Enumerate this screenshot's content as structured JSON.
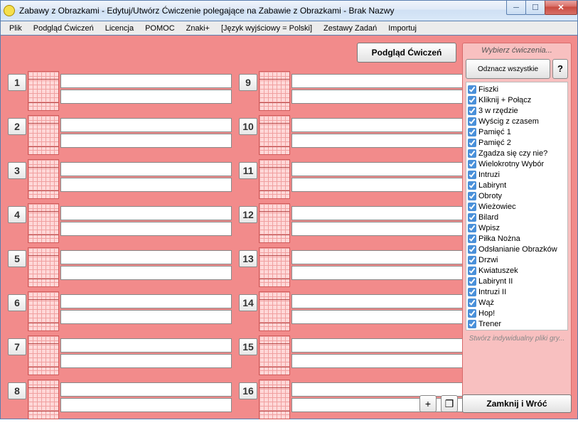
{
  "window": {
    "title": "Zabawy z Obrazkami - Edytuj/Utwórz Ćwiczenie polegające na Zabawie z Obrazkami - Brak Nazwy"
  },
  "menu": {
    "items": [
      "Plik",
      "Podgląd Ćwiczeń",
      "Licencja",
      "POMOC",
      "Znaki+",
      "[Język wyjściowy = Polski]",
      "Zestawy Zadań",
      "Importuj"
    ]
  },
  "buttons": {
    "preview": "Podgląd Ćwiczeń",
    "deselect_all": "Odznacz wszystkie",
    "help": "?",
    "close_return": "Zamknij i Wróć",
    "add": "+",
    "duplicate": "❐"
  },
  "right_panel": {
    "title": "Wybierz ćwiczenia...",
    "footer": "Stwórz indywidualny pliki gry...",
    "exercises": [
      "Fiszki",
      "Kliknij + Połącz",
      "3 w rzędzie",
      "Wyścig z czasem",
      "Pamięć 1",
      "Pamięć 2",
      "Zgadza się czy nie?",
      "Wielokrotny Wybór",
      "Intruzi",
      "Labirynt",
      "Obroty",
      "Wieżowiec",
      "Bilard",
      "Wpisz",
      "Piłka Nożna",
      "Odsłanianie Obrazków",
      "Drzwi",
      "Kwiatuszek",
      "Labirynt II",
      "Intruzi II",
      "Wąż",
      "Hop!",
      "Trener"
    ]
  },
  "grid": {
    "left": [
      {
        "num": "1",
        "a": "",
        "b": ""
      },
      {
        "num": "2",
        "a": "",
        "b": ""
      },
      {
        "num": "3",
        "a": "",
        "b": ""
      },
      {
        "num": "4",
        "a": "",
        "b": ""
      },
      {
        "num": "5",
        "a": "",
        "b": ""
      },
      {
        "num": "6",
        "a": "",
        "b": ""
      },
      {
        "num": "7",
        "a": "",
        "b": ""
      },
      {
        "num": "8",
        "a": "",
        "b": ""
      }
    ],
    "right": [
      {
        "num": "9",
        "a": "",
        "b": ""
      },
      {
        "num": "10",
        "a": "",
        "b": ""
      },
      {
        "num": "11",
        "a": "",
        "b": ""
      },
      {
        "num": "12",
        "a": "",
        "b": ""
      },
      {
        "num": "13",
        "a": "",
        "b": ""
      },
      {
        "num": "14",
        "a": "",
        "b": ""
      },
      {
        "num": "15",
        "a": "",
        "b": ""
      },
      {
        "num": "16",
        "a": "",
        "b": ""
      }
    ]
  }
}
